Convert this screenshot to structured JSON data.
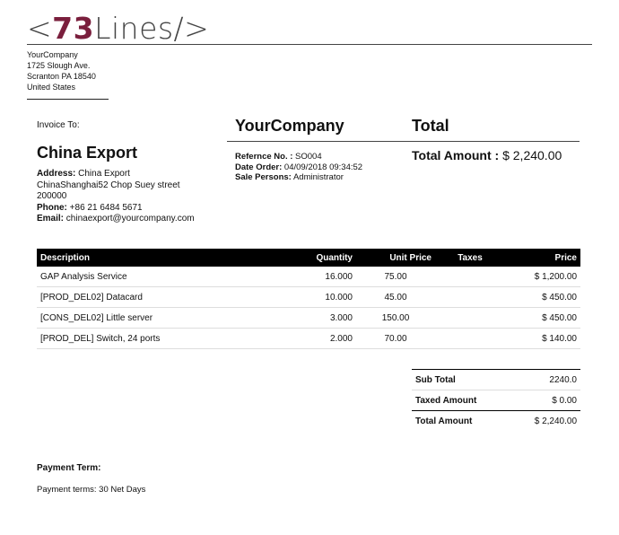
{
  "logo": {
    "open": "<",
    "number": "73",
    "text": "Lines/>"
  },
  "company": {
    "name": "YourCompany",
    "street": "1725 Slough Ave.",
    "city_line": "Scranton PA 18540",
    "country": "United States"
  },
  "customer": {
    "invoice_to_label": "Invoice To:",
    "name": "China Export",
    "address_label": "Address:",
    "address_name": "China Export",
    "address_street": "ChinaShanghai52 Chop Suey street",
    "address_zip": "200000",
    "phone_label": "Phone:",
    "phone": "+86 21 6484 5671",
    "email_label": "Email:",
    "email": "chinaexport@yourcompany.com"
  },
  "order": {
    "company_title": "YourCompany",
    "total_title": "Total",
    "reference_label": "Refernce No. :",
    "reference": "SO004",
    "date_label": "Date Order:",
    "date": "04/09/2018 09:34:52",
    "salesperson_label": "Sale Persons:",
    "salesperson": "Administrator",
    "total_amount_label": "Total Amount :",
    "total_amount": "$ 2,240.00"
  },
  "lines": {
    "headers": {
      "description": "Description",
      "quantity": "Quantity",
      "unit_price": "Unit Price",
      "taxes": "Taxes",
      "price": "Price"
    },
    "rows": [
      {
        "description": "GAP Analysis Service",
        "quantity": "16.000",
        "unit_price": "75.00",
        "taxes": "",
        "price": "$ 1,200.00"
      },
      {
        "description": "[PROD_DEL02] Datacard",
        "quantity": "10.000",
        "unit_price": "45.00",
        "taxes": "",
        "price": "$ 450.00"
      },
      {
        "description": "[CONS_DEL02] Little server",
        "quantity": "3.000",
        "unit_price": "150.00",
        "taxes": "",
        "price": "$ 450.00"
      },
      {
        "description": "[PROD_DEL] Switch, 24 ports",
        "quantity": "2.000",
        "unit_price": "70.00",
        "taxes": "",
        "price": "$ 140.00"
      }
    ]
  },
  "totals": {
    "subtotal_label": "Sub Total",
    "subtotal": "2240.0",
    "taxed_label": "Taxed Amount",
    "taxed": "$ 0.00",
    "total_label": "Total Amount",
    "total": "$ 2,240.00"
  },
  "payment": {
    "heading": "Payment Term:",
    "terms": "Payment terms: 30 Net Days"
  }
}
